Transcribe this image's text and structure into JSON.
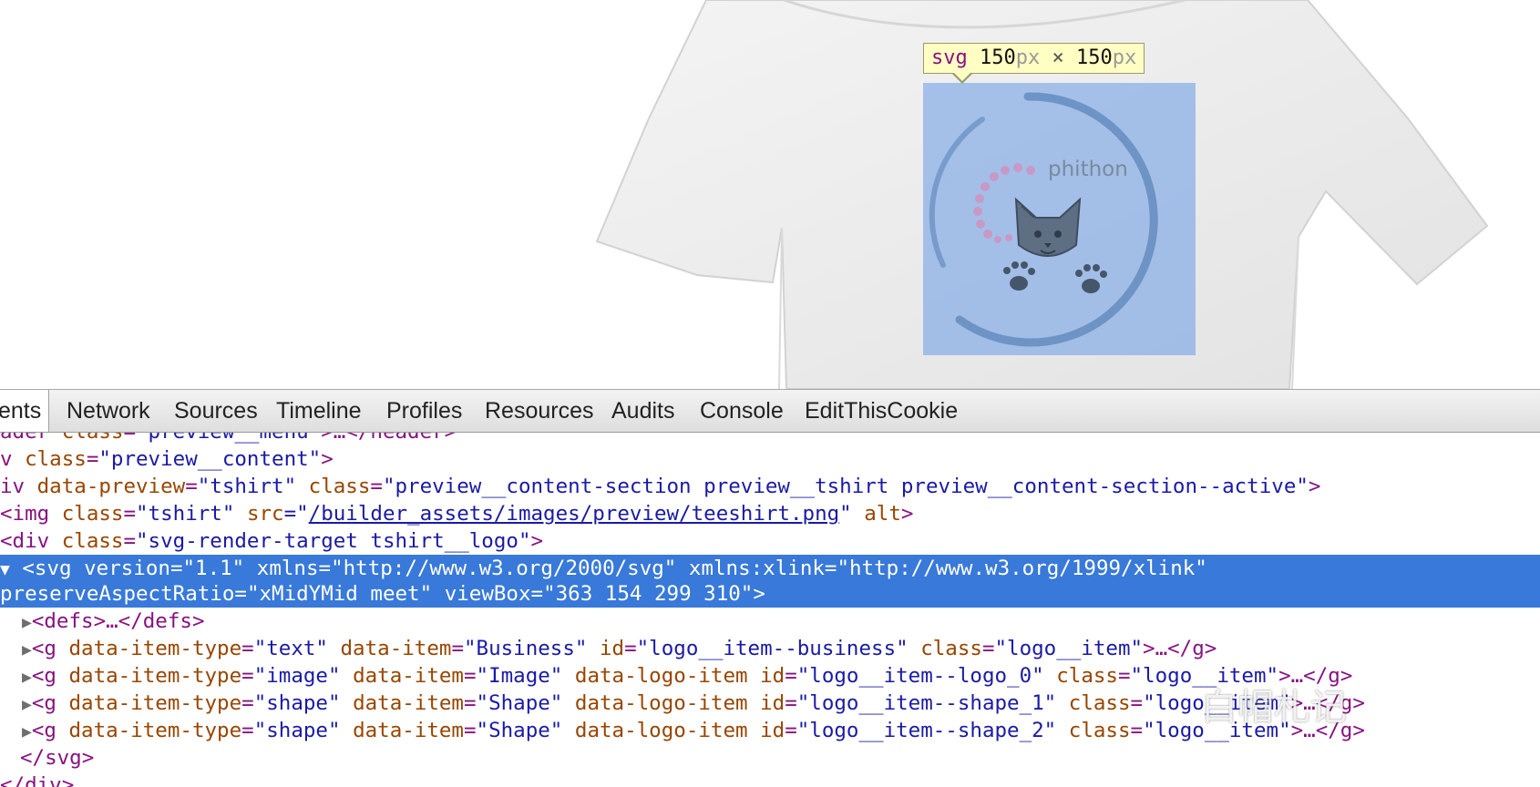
{
  "tooltip": {
    "tag": "svg",
    "width": "150",
    "height": "150",
    "unit": "px",
    "separator": "×"
  },
  "logo": {
    "text": "phithon"
  },
  "devtools": {
    "tabs": [
      "ents",
      "Network",
      "Sources",
      "Timeline",
      "Profiles",
      "Resources",
      "Audits",
      "Console",
      "EditThisCookie"
    ],
    "active_tab": "ents"
  },
  "code": {
    "l0": {
      "t1": "ader ",
      "a1": "class",
      "e1": "=",
      "v1": "\"preview__menu\"",
      "t2": ">…</header>"
    },
    "l1": {
      "t1": "v ",
      "a1": "class",
      "e1": "=",
      "v1": "\"preview__content\"",
      "t2": ">"
    },
    "l2": {
      "t1": "iv ",
      "a1": "data-preview",
      "e1": "=",
      "v1": "\"tshirt\"",
      "a2": "class",
      "e2": "=",
      "v2": "\"preview__content-section preview__tshirt preview__content-section--active\"",
      "t2": ">"
    },
    "l3": {
      "t1": "<img ",
      "a1": "class",
      "e1": "=",
      "v1": "\"tshirt\"",
      "a2": "src",
      "e2": "=\"",
      "link": "/builder_assets/images/preview/teeshirt.png",
      "q": "\"",
      "a3": "alt",
      "t2": ">"
    },
    "l4": {
      "t1": "<div ",
      "a1": "class",
      "e1": "=",
      "v1": "\"svg-render-target tshirt__logo\"",
      "t2": ">"
    },
    "l5": {
      "tri": "▼",
      "t1": "<svg ",
      "a1": "version",
      "e1": "=",
      "v1": "\"1.1\"",
      "a2": "xmlns",
      "e2": "=",
      "v2": "\"http://www.w3.org/2000/svg\"",
      "a3": "xmlns:xlink",
      "e3": "=",
      "v3": "\"http://www.w3.org/1999/xlink\""
    },
    "l6": {
      "a1": "preserveAspectRatio",
      "e1": "=",
      "v1": "\"xMidYMid meet\"",
      "a2": "viewBox",
      "e2": "=",
      "v2": "\"363 154 299 310\"",
      "t2": ">"
    },
    "l7": {
      "tri": "▶",
      "t1": "<defs>…</defs>"
    },
    "l8": {
      "tri": "▶",
      "t1": "<g ",
      "a1": "data-item-type",
      "e1": "=",
      "v1": "\"text\"",
      "a2": "data-item",
      "e2": "=",
      "v2": "\"Business\"",
      "a3": "id",
      "e3": "=",
      "v3": "\"logo__item--business\"",
      "a4": "class",
      "e4": "=",
      "v4": "\"logo__item\"",
      "t2": ">…</g>"
    },
    "l9": {
      "tri": "▶",
      "t1": "<g ",
      "a1": "data-item-type",
      "e1": "=",
      "v1": "\"image\"",
      "a2": "data-item",
      "e2": "=",
      "v2": "\"Image\"",
      "a3": "data-logo-item",
      "a4": "id",
      "e4": "=",
      "v4": "\"logo__item--logo_0\"",
      "a5": "class",
      "e5": "=",
      "v5": "\"logo__item\"",
      "t2": ">…</g>"
    },
    "l10": {
      "tri": "▶",
      "t1": "<g ",
      "a1": "data-item-type",
      "e1": "=",
      "v1": "\"shape\"",
      "a2": "data-item",
      "e2": "=",
      "v2": "\"Shape\"",
      "a3": "data-logo-item",
      "a4": "id",
      "e4": "=",
      "v4": "\"logo__item--shape_1\"",
      "a5": "class",
      "e5": "=",
      "v5": "\"logo__item\"",
      "t2": ">…</g>"
    },
    "l11": {
      "tri": "▶",
      "t1": "<g ",
      "a1": "data-item-type",
      "e1": "=",
      "v1": "\"shape\"",
      "a2": "data-item",
      "e2": "=",
      "v2": "\"Shape\"",
      "a3": "data-logo-item",
      "a4": "id",
      "e4": "=",
      "v4": "\"logo__item--shape_2\"",
      "a5": "class",
      "e5": "=",
      "v5": "\"logo__item\"",
      "t2": ">…</g>"
    },
    "l12": {
      "t1": "</svg>"
    },
    "l13": {
      "t1": "</div>"
    }
  },
  "watermark": {
    "text": "白帽札记"
  },
  "colors": {
    "selection": "#3879d9",
    "tag": "#881280",
    "attr_name": "#994500",
    "attr_value": "#1a1aa6",
    "tooltip_bg": "#ffffc4",
    "highlight": "#7ca8e6"
  }
}
